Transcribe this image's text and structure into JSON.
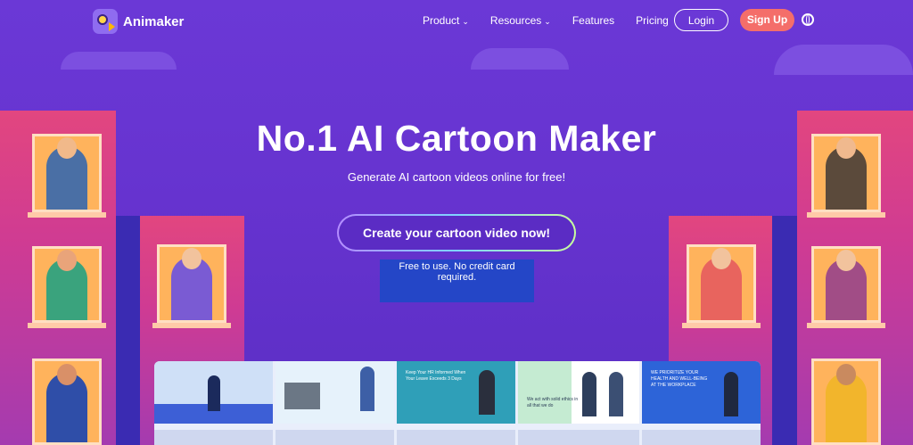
{
  "brand": {
    "name": "Animaker"
  },
  "nav": {
    "items": [
      {
        "label": "Product",
        "has_dropdown": true
      },
      {
        "label": "Resources",
        "has_dropdown": true
      },
      {
        "label": "Features",
        "has_dropdown": false
      },
      {
        "label": "Pricing",
        "has_dropdown": false
      }
    ],
    "login_label": "Login",
    "signup_label": "Sign Up",
    "language_icon": "globe-icon"
  },
  "hero": {
    "title": "No.1 AI Cartoon Maker",
    "subtitle": "Generate AI cartoon videos online for free!",
    "cta_label": "Create your cartoon video now!",
    "note": "Free to use. No credit card required."
  },
  "thumbnails": [
    {
      "text": ""
    },
    {
      "text": ""
    },
    {
      "text": "Keep Your HR Informed When Your Leave Exceeds 3 Days"
    },
    {
      "text": "We act with solid ethics in all that we do"
    },
    {
      "text": "WE PRIORITIZE YOUR HEALTH AND WELL-BEING AT THE WORKPLACE"
    }
  ],
  "colors": {
    "background": "#6a37d4",
    "signup": "#f46e6a",
    "note_highlight": "#2446c7",
    "building": "#d93f88",
    "window": "#ffb35c"
  }
}
